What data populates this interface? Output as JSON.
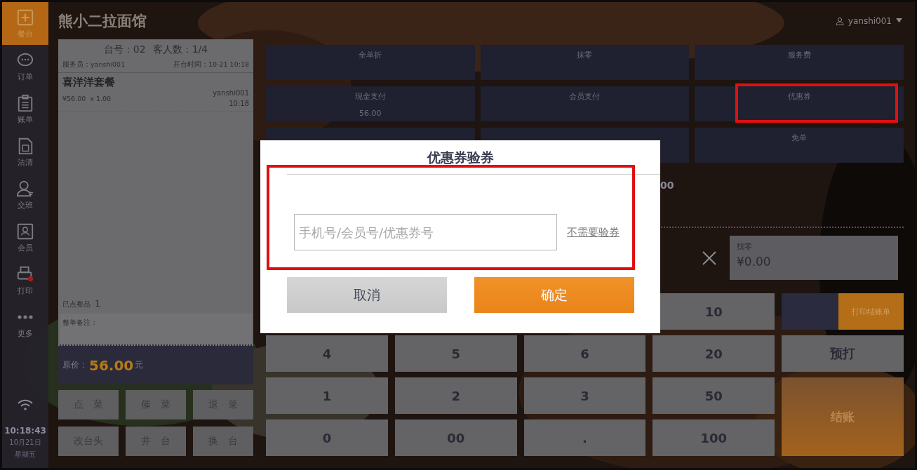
{
  "header": {
    "title": "熊小二拉面馆",
    "user": "yanshi001"
  },
  "sidebar": {
    "items": [
      {
        "label": "餐台",
        "selected": true
      },
      {
        "label": "订单",
        "selected": false
      },
      {
        "label": "账单",
        "selected": false
      },
      {
        "label": "沽清",
        "selected": false
      },
      {
        "label": "交班",
        "selected": false
      },
      {
        "label": "会员",
        "selected": false
      },
      {
        "label": "打印",
        "selected": false
      },
      {
        "label": "更多",
        "selected": false
      }
    ],
    "clock": {
      "time": "10:18:43",
      "date": "10月21日",
      "weekday": "星期五"
    }
  },
  "order": {
    "table_no": "台号：02",
    "guests": "客人数：1/4",
    "waiter": "服务员：yanshi001",
    "open_time": "开台时间：10-21 10:18",
    "items": [
      {
        "name": "喜洋洋套餐",
        "price": "¥56.00",
        "quantity": "x 1.00",
        "staff": "yanshi001",
        "time": "10:18"
      }
    ],
    "count_label": "已点餐品",
    "count": "1",
    "note_label": "整单备注：",
    "total_label": "原价：",
    "total": "56.00",
    "total_unit": "元",
    "actions": [
      "点 菜",
      "催 菜",
      "退 菜",
      "改台头",
      "井 台",
      "换 台"
    ]
  },
  "functions": [
    {
      "kind": "button",
      "label": "全单折",
      "highlighted": false
    },
    {
      "kind": "button",
      "label": "抹零",
      "highlighted": false
    },
    {
      "kind": "button",
      "label": "服务费",
      "highlighted": false
    },
    {
      "kind": "button",
      "label": "现金支付",
      "amount": "56.00",
      "highlighted": false
    },
    {
      "kind": "button",
      "label": "会员支付",
      "highlighted": false
    },
    {
      "kind": "button",
      "label": "优惠券",
      "highlighted": true
    },
    {
      "kind": "blank"
    },
    {
      "kind": "blank"
    },
    {
      "kind": "button",
      "label": "免单",
      "highlighted": false
    }
  ],
  "summary": {
    "amount_fragment": "00",
    "change_label": "找零",
    "change": "¥0.00"
  },
  "keypad": [
    {
      "kind": "key",
      "label": "10"
    },
    {
      "kind": "split",
      "label": "打印结账单"
    },
    {
      "kind": "key",
      "label": "4"
    },
    {
      "kind": "key",
      "label": "5"
    },
    {
      "kind": "key",
      "label": "6"
    },
    {
      "kind": "key",
      "label": "20"
    },
    {
      "kind": "key",
      "label": "预打"
    },
    {
      "kind": "key",
      "label": "1"
    },
    {
      "kind": "key",
      "label": "2"
    },
    {
      "kind": "key",
      "label": "3"
    },
    {
      "kind": "key",
      "label": "50"
    },
    {
      "kind": "tall",
      "label": "结账"
    },
    {
      "kind": "key",
      "label": "0"
    },
    {
      "kind": "key",
      "label": "00"
    },
    {
      "kind": "key",
      "label": "."
    },
    {
      "kind": "key",
      "label": "100"
    }
  ],
  "dialog": {
    "title": "优惠券验券",
    "placeholder": "手机号/会员号/优惠券号",
    "link": "不需要验券",
    "highlighted": true,
    "buttons": [
      {
        "label": "取消",
        "kind": "secondary"
      },
      {
        "label": "确定",
        "kind": "primary"
      }
    ]
  }
}
